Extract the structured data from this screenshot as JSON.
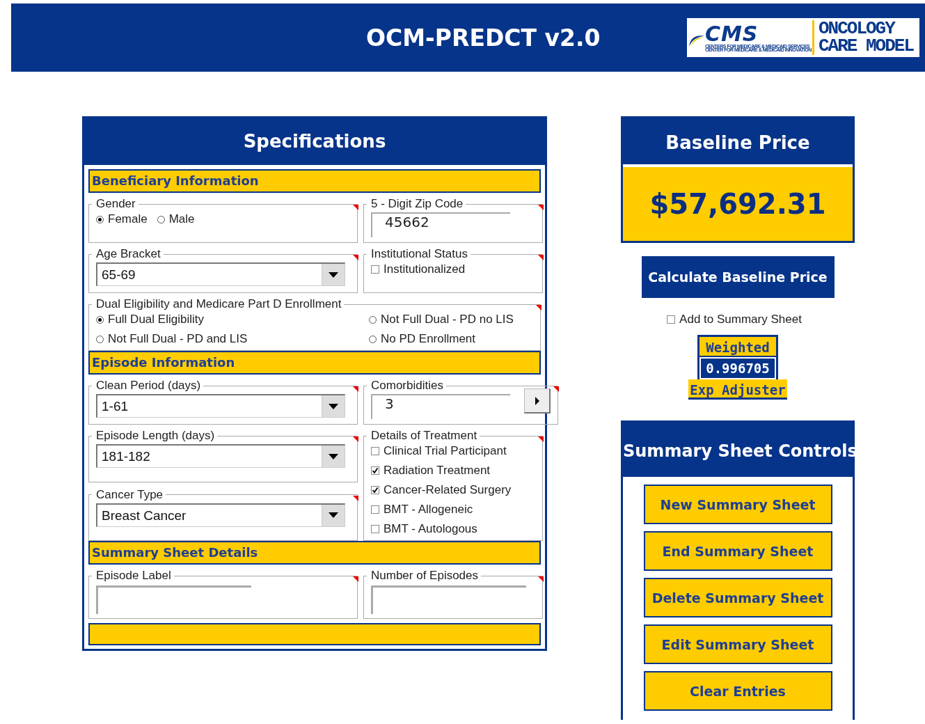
{
  "header": {
    "title": "OCM-PREDCT v2.0",
    "logo": {
      "mark": "CMS",
      "line1": "CENTERS FOR MEDICARE & MEDICAID SERVICES",
      "line2": "CENTER FOR MEDICARE & MEDICAID INNOVATION",
      "model1": "ONCOLOGY",
      "model2": "CARE MODEL"
    }
  },
  "specifications": {
    "title": "Specifications",
    "sections": [
      {
        "title": "Beneficiary Information",
        "rows": [
          {
            "cells": [
              {
                "groups": [
                  {
                    "kind": "radio",
                    "label": "Gender",
                    "options": [
                      {
                        "label": "Female",
                        "selected": true
                      },
                      {
                        "label": "Male",
                        "selected": false
                      }
                    ]
                  }
                ]
              },
              {
                "groups": [
                  {
                    "kind": "text",
                    "label": "5 - Digit Zip Code",
                    "value": "45662"
                  }
                ]
              }
            ]
          },
          {
            "cells": [
              {
                "groups": [
                  {
                    "kind": "dropdown",
                    "label": "Age Bracket",
                    "value": "65-69"
                  }
                ]
              },
              {
                "groups": [
                  {
                    "kind": "checkbox",
                    "label": "Institutional Status",
                    "options": [
                      {
                        "label": "Institutionalized",
                        "checked": false
                      }
                    ]
                  }
                ]
              }
            ]
          },
          {
            "cells": [
              {
                "groups": [
                  {
                    "kind": "radio-grid",
                    "label": "Dual Eligibility and Medicare Part D Enrollment",
                    "options": [
                      {
                        "label": "Full Dual Eligibility",
                        "selected": true
                      },
                      {
                        "label": "Not Full Dual - PD no LIS",
                        "selected": false
                      },
                      {
                        "label": "Not Full Dual - PD and LIS",
                        "selected": false
                      },
                      {
                        "label": "No PD Enrollment",
                        "selected": false
                      }
                    ]
                  }
                ]
              }
            ]
          }
        ]
      },
      {
        "title": "Episode Information",
        "rows": [
          {
            "cells": [
              {
                "groups": [
                  {
                    "kind": "dropdown",
                    "label": "Clean Period (days)",
                    "value": "1-61"
                  }
                ]
              },
              {
                "groups": [
                  {
                    "kind": "stepper",
                    "label": "Comorbidities",
                    "value": "3"
                  }
                ]
              }
            ]
          },
          {
            "cells": [
              {
                "groups": [
                  {
                    "kind": "dropdown",
                    "label": "Episode Length (days)",
                    "value": "181-182"
                  },
                  {
                    "kind": "dropdown",
                    "label": "Cancer Type",
                    "value": "Breast Cancer"
                  }
                ]
              },
              {
                "groups": [
                  {
                    "kind": "checkbox",
                    "label": "Details of Treatment",
                    "options": [
                      {
                        "label": "Clinical Trial Participant",
                        "checked": false
                      },
                      {
                        "label": "Radiation Treatment",
                        "checked": true
                      },
                      {
                        "label": "Cancer-Related Surgery",
                        "checked": true
                      },
                      {
                        "label": "BMT - Allogeneic",
                        "checked": false
                      },
                      {
                        "label": "BMT - Autologous",
                        "checked": false
                      }
                    ]
                  }
                ]
              }
            ]
          }
        ]
      },
      {
        "title": "Summary Sheet Details",
        "rows": [
          {
            "cells": [
              {
                "groups": [
                  {
                    "kind": "entry",
                    "label": "Episode Label"
                  }
                ]
              },
              {
                "groups": [
                  {
                    "kind": "entry",
                    "label": "Number of Episodes"
                  }
                ]
              }
            ]
          }
        ]
      }
    ]
  },
  "baseline": {
    "title": "Baseline Price",
    "price": "$57,692.31",
    "button": "Calculate Baseline Price",
    "add_to_summary": {
      "label": "Add to Summary Sheet",
      "checked": false
    },
    "adjuster": {
      "top": "Weighted",
      "value": "0.996705",
      "bottom": "Exp Adjuster"
    }
  },
  "summary_controls": {
    "title": "Summary Sheet Controls",
    "buttons": [
      "New Summary Sheet",
      "End Summary Sheet",
      "Delete Summary Sheet",
      "Edit Summary Sheet",
      "Clear Entries"
    ]
  }
}
